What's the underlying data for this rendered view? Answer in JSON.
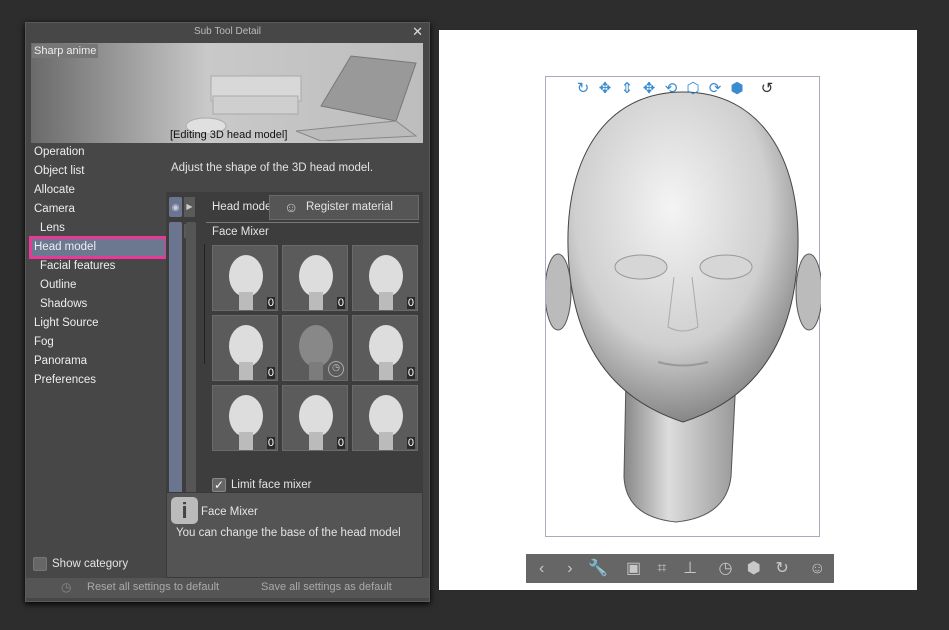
{
  "panel": {
    "title": "Sub Tool Detail",
    "close_icon": "close-icon",
    "preset_name": "Sharp anime",
    "preview_caption": "[Editing 3D head model]",
    "nav": [
      {
        "label": "Operation",
        "sub": false
      },
      {
        "label": "Object list",
        "sub": false
      },
      {
        "label": "Allocate",
        "sub": false
      },
      {
        "label": "Camera",
        "sub": false
      },
      {
        "label": "Lens",
        "sub": true
      },
      {
        "label": "Head model",
        "sub": false,
        "selected": true
      },
      {
        "label": "Facial features",
        "sub": true
      },
      {
        "label": "Outline",
        "sub": true
      },
      {
        "label": "Shadows",
        "sub": true
      },
      {
        "label": "Light Source",
        "sub": false
      },
      {
        "label": "Fog",
        "sub": false
      },
      {
        "label": "Panorama",
        "sub": false
      },
      {
        "label": "Preferences",
        "sub": false
      }
    ],
    "description": "Adjust the shape of the 3D head model.",
    "head_model_label": "Head model",
    "register_material": "Register material",
    "face_mixer_label": "Face Mixer",
    "thumbnails": [
      "0",
      "0",
      "0",
      "0",
      "",
      "0",
      "0",
      "0",
      "0"
    ],
    "limit_face_mixer": {
      "label": "Limit face mixer",
      "checked": true
    },
    "info": {
      "title": "Face Mixer",
      "text": "You can change the base of the head model"
    },
    "show_category": {
      "label": "Show category",
      "checked": false
    },
    "reset_label": "Reset all settings to default",
    "save_label": "Save all settings as default",
    "highlight_color": "#e8389a"
  },
  "canvas": {
    "top_toolbar": [
      "camera-rotate-icon",
      "pan-icon",
      "zoom-camera-icon",
      "move-icon",
      "rotate-icon",
      "rotate-xy-icon",
      "rotate-plane-icon",
      "move-plane-icon",
      "reset-rotation-icon"
    ],
    "bottom_toolbar": [
      "previous-icon",
      "next-icon",
      "wrench-icon",
      "camera-angle-icon",
      "fit-icon",
      "ground-icon",
      "reset-position-icon",
      "reset-model-icon",
      "reset-rotation-icon",
      "register-material-icon"
    ],
    "accent": "#3a8ccf"
  }
}
